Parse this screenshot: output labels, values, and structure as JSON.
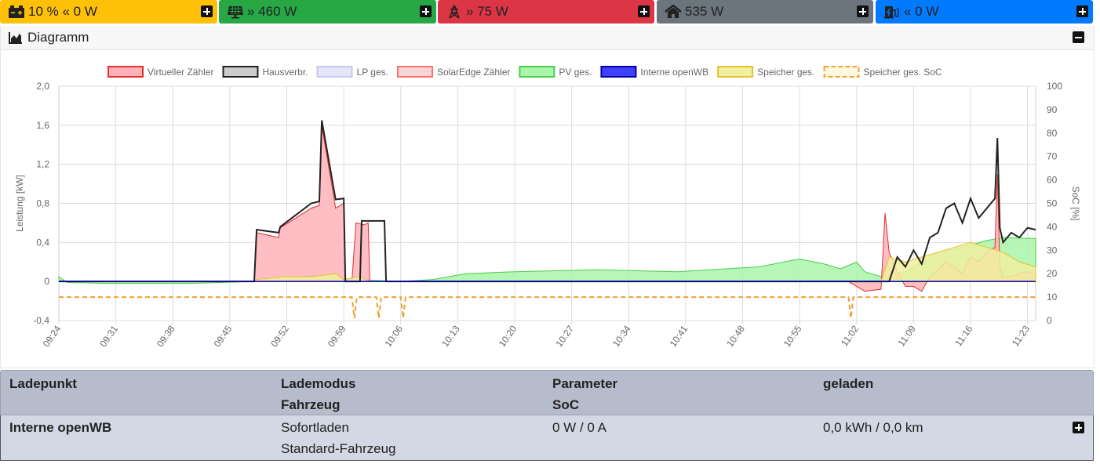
{
  "topbar": {
    "tiles": [
      {
        "icon": "car-battery-icon",
        "arrow": "chevrons-left-icon",
        "text": "10 % « 0 W",
        "color": "#fec107"
      },
      {
        "icon": "solar-panel-icon",
        "arrow": "chevrons-right-icon",
        "text": "» 460 W",
        "color": "#28a745"
      },
      {
        "icon": "power-tower-icon",
        "arrow": "chevrons-right-icon",
        "text": "» 75 W",
        "color": "#dc3545"
      },
      {
        "icon": "home-icon",
        "text": "535 W",
        "color": "#6c757d"
      },
      {
        "icon": "charging-station-icon",
        "arrow": "chevrons-left-icon",
        "text": "« 0 W",
        "color": "#007bff"
      }
    ]
  },
  "diagram": {
    "title": "Diagramm",
    "collapse_icon": "minus-square-icon"
  },
  "chart_data": {
    "type": "area",
    "title": "",
    "ylabel": "Leistung [kW]",
    "y2label": "SoC [%]",
    "ylim": [
      -0.4,
      2.0
    ],
    "y_ticks": [
      "-0,4",
      "0",
      "0,4",
      "0,8",
      "1,2",
      "1,6",
      "2,0"
    ],
    "y2lim": [
      0,
      100
    ],
    "y2_ticks": [
      "0",
      "10",
      "20",
      "30",
      "40",
      "50",
      "60",
      "70",
      "80",
      "90",
      "100"
    ],
    "x_ticks": [
      "09:24",
      "09:31",
      "09:38",
      "09:45",
      "09:52",
      "09:59",
      "10:06",
      "10:13",
      "10:20",
      "10:27",
      "10:34",
      "10:41",
      "10:48",
      "10:55",
      "11:02",
      "11:09",
      "11:16",
      "11:23"
    ],
    "legend_position": "top",
    "legend": [
      {
        "name": "Virtueller Zähler",
        "fill": "#ffb3b8",
        "stroke": "#e03030",
        "dashed": false
      },
      {
        "name": "Hausverbr.",
        "fill": "#cccccc",
        "stroke": "#222222",
        "dashed": false
      },
      {
        "name": "LP ges.",
        "fill": "#e6e6fa",
        "stroke": "#c8c8f0",
        "dashed": false
      },
      {
        "name": "SolarEdge Zähler",
        "fill": "#ffd5d5",
        "stroke": "#ff7070",
        "dashed": false
      },
      {
        "name": "PV ges.",
        "fill": "#a9f5a9",
        "stroke": "#4ccc4c",
        "dashed": false
      },
      {
        "name": "Interne openWB",
        "fill": "#4040ff",
        "stroke": "#0000aa",
        "dashed": false
      },
      {
        "name": "Speicher ges.",
        "fill": "#f0f0a0",
        "stroke": "#e6c030",
        "dashed": false
      },
      {
        "name": "Speicher ges. SoC",
        "fill": "#fff8e0",
        "stroke": "#f0a030",
        "dashed": true
      }
    ],
    "series": [
      {
        "name": "Hausverbr.",
        "x": [
          "09:24",
          "09:48",
          "09:48.3",
          "09:51",
          "09:51.2",
          "09:55",
          "09:56",
          "09:56.3",
          "09:58",
          "09:59",
          "09:59.2",
          "10:01",
          "10:01.2",
          "10:04",
          "10:04.2",
          "11:06",
          "11:07",
          "11:08",
          "11:09",
          "11:10",
          "11:11",
          "11:12",
          "11:13",
          "11:14",
          "11:15",
          "11:16",
          "11:17",
          "11:18",
          "11:19",
          "11:19.3",
          "11:19.6",
          "11:20",
          "11:21",
          "11:22",
          "11:23",
          "11:24"
        ],
        "y": [
          0,
          0,
          0.53,
          0.5,
          0.56,
          0.8,
          0.82,
          1.65,
          0.84,
          0.85,
          0,
          0,
          0.62,
          0.62,
          0,
          0,
          0.25,
          0.15,
          0.32,
          0.18,
          0.45,
          0.5,
          0.75,
          0.8,
          0.6,
          0.85,
          0.65,
          0.75,
          0.85,
          1.47,
          0.55,
          0.4,
          0.5,
          0.45,
          0.55,
          0.53
        ]
      },
      {
        "name": "Virtueller Zähler",
        "x": [
          "09:24",
          "09:48",
          "09:48.3",
          "09:51",
          "09:51.2",
          "09:55",
          "09:56",
          "09:56.3",
          "09:58",
          "09:59",
          "09:59.2",
          "10:00",
          "10:00.5",
          "10:01.5",
          "10:02",
          "10:02.2",
          "10:05",
          "11:01",
          "11:03",
          "11:05",
          "11:05.5",
          "11:06",
          "11:07",
          "11:08",
          "11:09",
          "11:10",
          "11:11",
          "11:12",
          "11:13",
          "11:14",
          "11:15",
          "11:16",
          "11:17",
          "11:18",
          "11:19",
          "11:19.3",
          "11:19.6",
          "11:20",
          "11:21",
          "11:22",
          "11:23",
          "11:24"
        ],
        "y": [
          0,
          0,
          0.5,
          0.45,
          0.55,
          0.75,
          0.78,
          1.6,
          0.75,
          0.8,
          0,
          0,
          0.6,
          0.58,
          0.6,
          0,
          0,
          0,
          -0.1,
          -0.08,
          0.7,
          0.3,
          0.1,
          -0.05,
          -0.05,
          -0.1,
          0.05,
          0.12,
          0.2,
          0.15,
          0.08,
          0.25,
          0.2,
          0.3,
          0.35,
          1.1,
          0.15,
          0.05,
          0.05,
          0.08,
          0.1,
          0.07
        ]
      },
      {
        "name": "PV ges.",
        "x": [
          "09:24",
          "09:25",
          "09:30",
          "09:40",
          "09:48",
          "09:55",
          "10:00",
          "10:06",
          "10:10",
          "10:14",
          "10:20",
          "10:30",
          "10:40",
          "10:50",
          "10:55",
          "10:58",
          "11:00",
          "11:02",
          "11:03",
          "11:05",
          "11:08",
          "11:10",
          "11:12",
          "11:15",
          "11:18",
          "11:20",
          "11:24"
        ],
        "y": [
          0.05,
          -0.01,
          -0.02,
          -0.02,
          0,
          0.06,
          0.02,
          0,
          0.02,
          0.08,
          0.1,
          0.12,
          0.1,
          0.15,
          0.23,
          0.18,
          0.13,
          0.2,
          0.1,
          0.05,
          0.1,
          0.2,
          0.3,
          0.35,
          0.42,
          0.45,
          0.44
        ]
      },
      {
        "name": "Speicher ges.",
        "x": [
          "09:24",
          "09:48",
          "09:48.3",
          "09:52",
          "09:55",
          "09:58",
          "09:59",
          "10:01",
          "10:02",
          "11:05",
          "11:06",
          "11:08",
          "11:10",
          "11:12",
          "11:14",
          "11:16",
          "11:18",
          "11:20",
          "11:22",
          "11:24"
        ],
        "y": [
          0,
          0,
          0.02,
          0.05,
          0.05,
          0.08,
          0.02,
          0.05,
          0,
          0,
          0.25,
          0.2,
          0.25,
          0.3,
          0.35,
          0.4,
          0.35,
          0.3,
          0.2,
          0.15
        ]
      },
      {
        "name": "Speicher ges. SoC",
        "x": [
          "09:24",
          "10:00",
          "10:00.3",
          "10:00.6",
          "10:03",
          "10:03.3",
          "10:03.6",
          "10:06",
          "10:06.3",
          "10:06.6",
          "11:01",
          "11:01.3",
          "11:01.6",
          "11:24"
        ],
        "y2": [
          10,
          10,
          1,
          10,
          10,
          1,
          10,
          10,
          1,
          10,
          10,
          1,
          10,
          10
        ]
      },
      {
        "name": "Interne openWB",
        "x": [
          "09:24",
          "11:24"
        ],
        "y": [
          0,
          0
        ]
      }
    ]
  },
  "table": {
    "headers": [
      {
        "line1": "Ladepunkt",
        "line2": ""
      },
      {
        "line1": "Lademodus",
        "line2": "Fahrzeug"
      },
      {
        "line1": "Parameter",
        "line2": "SoC"
      },
      {
        "line1": "geladen",
        "line2": ""
      }
    ],
    "rows": [
      {
        "ladepunkt": "Interne openWB",
        "modus": "Sofortladen",
        "fahrzeug": "Standard-Fahrzeug",
        "parameter": "0 W / 0 A",
        "geladen": "0,0 kWh / 0,0 km"
      }
    ]
  }
}
